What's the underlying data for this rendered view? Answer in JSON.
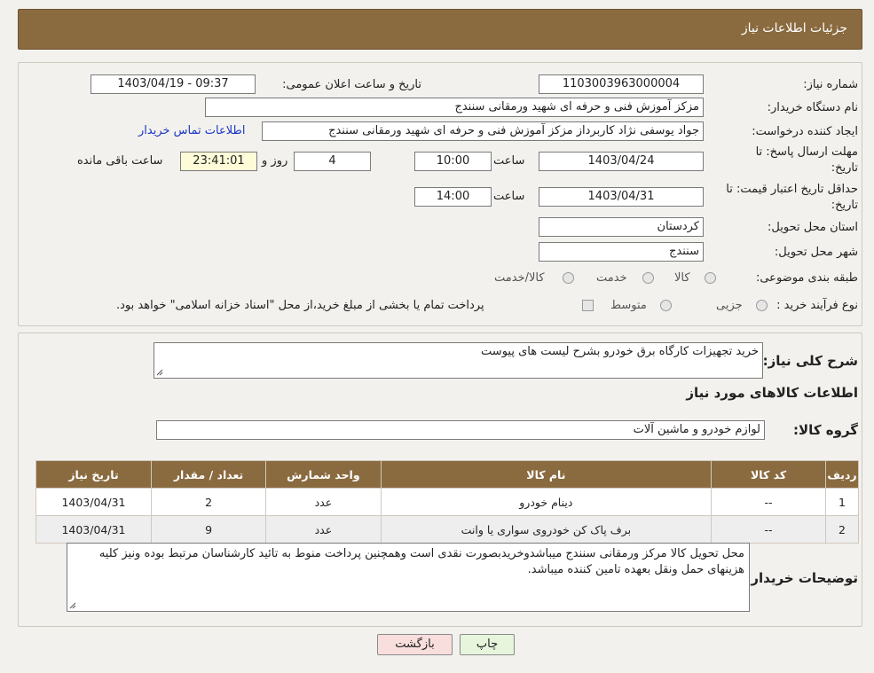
{
  "header": {
    "title": "جزئیات اطلاعات نیاز"
  },
  "form": {
    "need_number_label": "شماره نیاز:",
    "need_number": "1103003963000004",
    "announce_label": "تاریخ و ساعت اعلان عمومی:",
    "announce_value": "1403/04/19 - 09:37",
    "buyer_org_label": "نام دستگاه خریدار:",
    "buyer_org": "مزکز آموزش فنی و حرفه ای شهید ورمقانی سنندج",
    "creator_label": "ایجاد کننده درخواست:",
    "creator": "جواد یوسفی نژاد کاربرداز مزکز آموزش فنی و حرفه ای شهید ورمقانی سنندج",
    "contact_link": "اطلاعات تماس خریدار",
    "deadline_label_1": "مهلت ارسال پاسخ: تا",
    "deadline_label_2": "تاریخ:",
    "deadline_date": "1403/04/24",
    "time_label": "ساعت",
    "deadline_time": "10:00",
    "days_value": "4",
    "days_label": "روز و",
    "remaining_time": "23:41:01",
    "remaining_label": "ساعت باقی مانده",
    "validity_label_1": "حداقل تاریخ اعتبار قیمت: تا",
    "validity_label_2": "تاریخ:",
    "validity_date": "1403/04/31",
    "validity_time_label": "ساعت",
    "validity_time": "14:00",
    "province_label": "استان محل تحویل:",
    "province": "کردستان",
    "city_label": "شهر محل تحویل:",
    "city": "سنندج",
    "category_label": "طبقه بندی موضوعی:",
    "category_options": [
      "کالا",
      "خدمت",
      "کالا/خدمت"
    ],
    "process_label": "نوع فرآیند خرید :",
    "process_options": [
      "جزیی",
      "متوسط"
    ],
    "payment_note": "پرداخت تمام یا بخشی از مبلغ خرید،از محل \"اسناد خزانه اسلامی\" خواهد بود."
  },
  "details": {
    "description_label": "شرح کلی نیاز:",
    "description": "خرید تجهیزات کارگاه برق خودرو بشرح لیست های پیوست",
    "goods_info_title": "اطلاعات کالاهای مورد نیاز",
    "goods_group_label": "گروه کالا:",
    "goods_group": "لوازم خودرو و ماشین آلات"
  },
  "table": {
    "headers": [
      "ردیف",
      "کد کالا",
      "نام کالا",
      "واحد شمارش",
      "تعداد / مقدار",
      "تاریخ نیاز"
    ],
    "rows": [
      [
        "1",
        "--",
        "دینام خودرو",
        "عدد",
        "2",
        "1403/04/31"
      ],
      [
        "2",
        "--",
        "برف پاک کن خودروی سواری یا وانت",
        "عدد",
        "9",
        "1403/04/31"
      ]
    ]
  },
  "notes": {
    "label": "توضیحات خریدار:",
    "text": "محل تحویل کالا مرکز ورمقانی سنندج میباشدوخریدبصورت نقدی است وهمچنین پرداخت منوط به تائید کارشناسان مرتبط بوده ونیز کلیه هزینهای حمل ونقل بعهده تامین کننده میباشد."
  },
  "buttons": {
    "print": "چاپ",
    "back": "بازگشت"
  },
  "colors": {
    "header": "#8a6a3f",
    "back_button": "#f9dede",
    "print_button": "#e6f5dc",
    "link": "#1a36c4"
  }
}
